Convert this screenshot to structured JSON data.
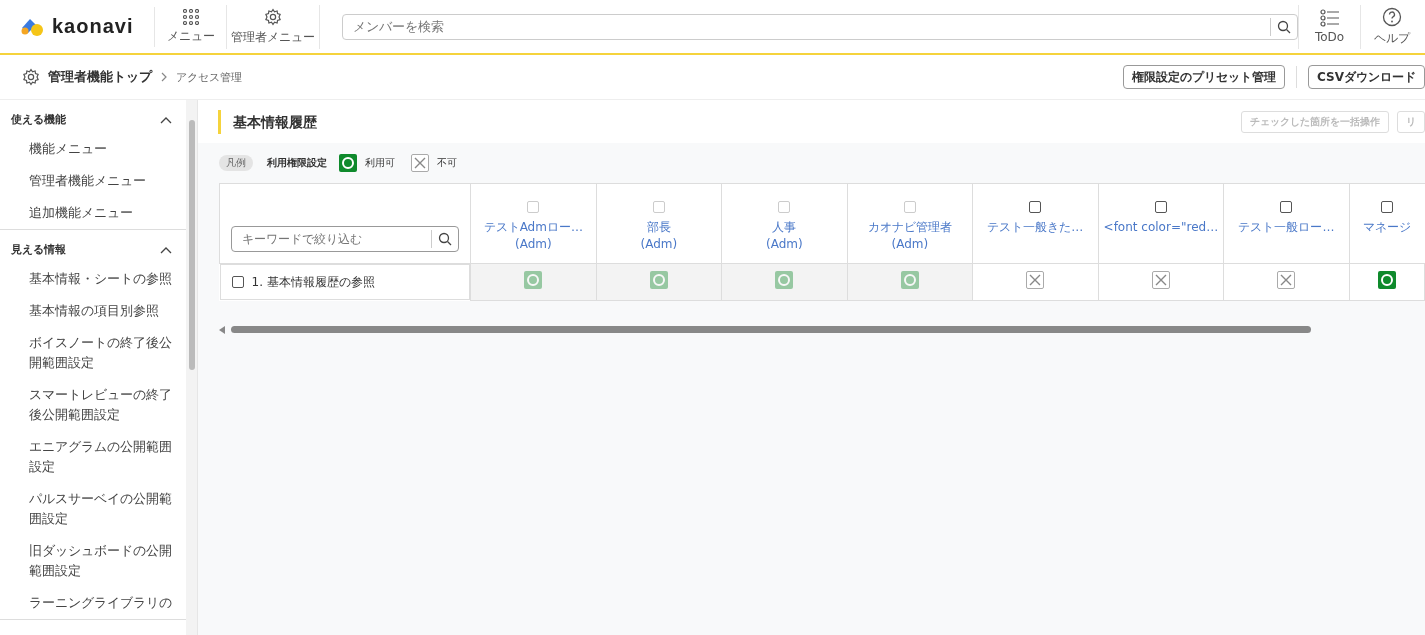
{
  "header": {
    "logo": "kaonavi",
    "nav": [
      {
        "kind": "grid",
        "label": "メニュー"
      },
      {
        "kind": "gear",
        "label": "管理者メニュー"
      }
    ],
    "search": {
      "placeholder": "メンバーを検索"
    },
    "right_nav": [
      {
        "kind": "todo",
        "label": "ToDo"
      },
      {
        "kind": "help",
        "label": "ヘルプ"
      }
    ]
  },
  "breadcrumb": [
    "管理者機能トップ",
    "アクセス管理"
  ],
  "toolbar_buttons": [
    "権限設定のプリセット管理",
    "CSVダウンロード"
  ],
  "sidebar": {
    "sections": [
      {
        "title": "使える機能",
        "expanded": true,
        "items": [
          "機能メニュー",
          "管理者機能メニュー",
          "追加機能メニュー"
        ]
      },
      {
        "title": "見える情報",
        "expanded": true,
        "items": [
          "基本情報・シートの参照",
          "基本情報の項目別参照",
          "ボイスノートの終了後公開範囲設定",
          "スマートレビューの終了後公開範囲設定",
          "エニアグラムの公開範囲設定",
          "パルスサーベイの公開範囲設定",
          "旧ダッシュボードの公開範囲設定",
          "ラーニングライブラリの"
        ]
      }
    ]
  },
  "content": {
    "title": "基本情報履歴",
    "actions": [
      {
        "label": "チェックした箇所を一括操作",
        "disabled": true
      },
      {
        "label": "リ",
        "disabled": true
      }
    ],
    "legend": {
      "tag": "凡例",
      "title": "利用権限設定",
      "items": [
        {
          "kind": "ok",
          "label": "利用可"
        },
        {
          "kind": "ng",
          "label": "不可"
        }
      ]
    },
    "table": {
      "filter": {
        "placeholder": "キーワードで絞り込む"
      },
      "columns": [
        {
          "name": "テストAdmロー…",
          "sub": "(Adm)",
          "disabled": true,
          "checked": false
        },
        {
          "name": "部長",
          "sub": "(Adm)",
          "disabled": true,
          "checked": false
        },
        {
          "name": "人事",
          "sub": "(Adm)",
          "disabled": true,
          "checked": false
        },
        {
          "name": "カオナビ管理者",
          "sub": "(Adm)",
          "disabled": true,
          "checked": false
        },
        {
          "name": "テスト一般きた…",
          "disabled": false,
          "checked": false
        },
        {
          "name": "<font color=\"red…",
          "disabled": false,
          "checked": false
        },
        {
          "name": "テスト一般ロー…",
          "disabled": false,
          "checked": false
        },
        {
          "name": "マネージ",
          "disabled": false,
          "checked": false
        }
      ],
      "rows": [
        {
          "label": "1. 基本情報履歴の参照",
          "checked": false,
          "cells": [
            {
              "kind": "ok"
            },
            {
              "kind": "ok"
            },
            {
              "kind": "ok"
            },
            {
              "kind": "ok"
            },
            {
              "kind": "ng"
            },
            {
              "kind": "ng"
            },
            {
              "kind": "ng"
            },
            {
              "kind": "ok"
            }
          ]
        }
      ]
    }
  }
}
